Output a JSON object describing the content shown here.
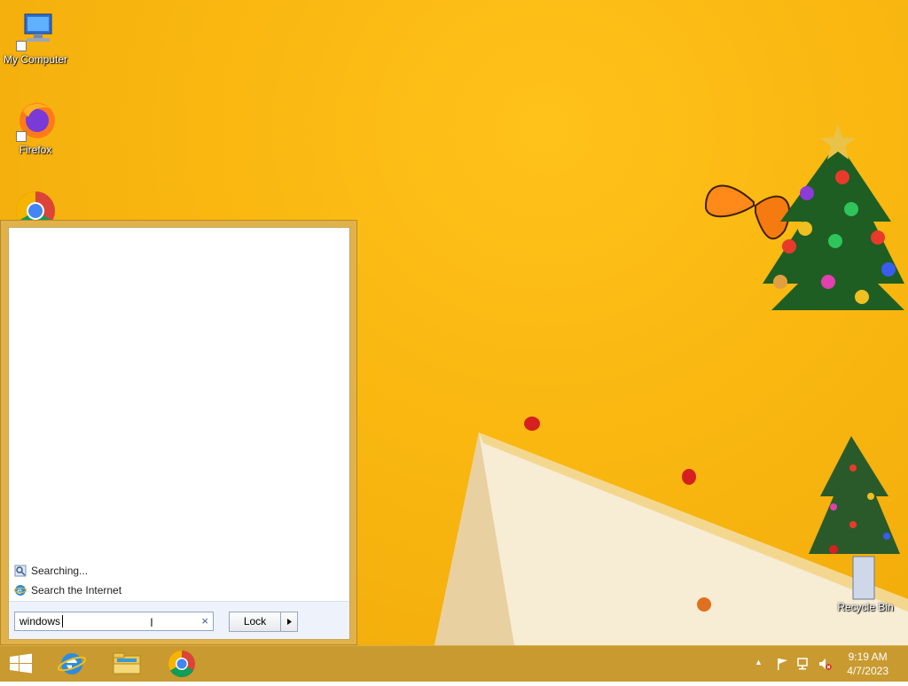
{
  "desktop": {
    "icons": [
      {
        "label": "My Computer",
        "icon": "computer-icon"
      },
      {
        "label": "Firefox",
        "icon": "firefox-icon"
      },
      {
        "label": "",
        "icon": "chrome-icon"
      },
      {
        "label": "Recycle Bin",
        "icon": "recycle-bin-icon"
      }
    ]
  },
  "start_menu": {
    "results": [
      {
        "label": "Searching...",
        "icon": "search-progress-icon"
      },
      {
        "label": "Search the Internet",
        "icon": "internet-explorer-icon"
      }
    ],
    "search": {
      "value": "windows",
      "clear_glyph": "×"
    },
    "power_button": {
      "label": "Lock",
      "arrow_glyph": "▶"
    }
  },
  "taskbar": {
    "buttons": [
      {
        "icon": "windows-start-icon"
      },
      {
        "icon": "internet-explorer-icon"
      },
      {
        "icon": "file-explorer-icon"
      },
      {
        "icon": "chrome-icon"
      }
    ],
    "tray": {
      "show_hidden_glyph": "▲",
      "icons": [
        "action-center-flag-icon",
        "network-icon",
        "volume-muted-icon"
      ]
    },
    "clock": {
      "time": "9:19 AM",
      "date": "4/7/2023"
    }
  },
  "colors": {
    "wallpaper": "#f9b710",
    "taskbar": "#c89a30",
    "start_menu_frame": "#e1b24a"
  }
}
